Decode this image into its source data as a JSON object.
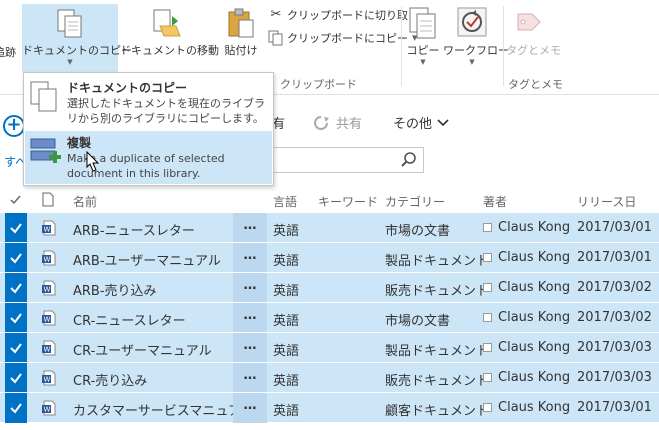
{
  "ribbon": {
    "clipped_left_label": "追跡",
    "copy_doc": "ドキュメントのコピー",
    "move_doc": "ドキュメントの移動",
    "paste": "貼付け",
    "cut_to_clipboard": "クリップボードに切り取り",
    "copy_to_clipboard": "クリップボードにコピー",
    "clipboard_group": "クリップボード",
    "copy": "コピー",
    "workflow": "ワークフロー",
    "tags_notes": "タグとメモ",
    "tags_group": "タグとメモ"
  },
  "menu": {
    "items": [
      {
        "title": "ドキュメントのコピー",
        "desc": "選択したドキュメントを現在のライブラリから別のライブラリにコピーします。"
      },
      {
        "title": "複製",
        "desc": "Make a duplicate of selected document in this library."
      }
    ]
  },
  "commandbar": {
    "clipped_link": "すべ",
    "share_clipped": "有",
    "share": "共有",
    "other": "その他"
  },
  "table": {
    "headers": [
      "名前",
      "言語",
      "キーワード",
      "カテゴリー",
      "著者",
      "リリース日"
    ],
    "rows": [
      {
        "name": "ARB-ニュースレター",
        "lang": "英語",
        "category": "市場の文書",
        "author": "Claus Kong",
        "date": "2017/03/01"
      },
      {
        "name": "ARB-ユーザーマニュアル",
        "lang": "英語",
        "category": "製品ドキュメント",
        "author": "Claus Kong",
        "date": "2017/03/01"
      },
      {
        "name": "ARB-売り込み",
        "lang": "英語",
        "category": "販売ドキュメント",
        "author": "Claus Kong",
        "date": "2017/03/02"
      },
      {
        "name": "CR-ニュースレター",
        "lang": "英語",
        "category": "市場の文書",
        "author": "Claus Kong",
        "date": "2017/03/02"
      },
      {
        "name": "CR-ユーザーマニュアル",
        "lang": "英語",
        "category": "製品ドキュメント",
        "author": "Claus Kong",
        "date": "2017/03/03"
      },
      {
        "name": "CR-売り込み",
        "lang": "英語",
        "category": "販売ドキュメント",
        "author": "Claus Kong",
        "date": "2017/03/03"
      },
      {
        "name": "カスタマーサービスマニュアル",
        "lang": "英語",
        "category": "顧客ドキュメント",
        "author": "Claus Kong",
        "date": "2017/03/01"
      }
    ],
    "more_glyph": "…"
  },
  "colors": {
    "accent": "#0072c6",
    "selection": "#cde6f7",
    "menu_highlight": "#cde6f7"
  }
}
